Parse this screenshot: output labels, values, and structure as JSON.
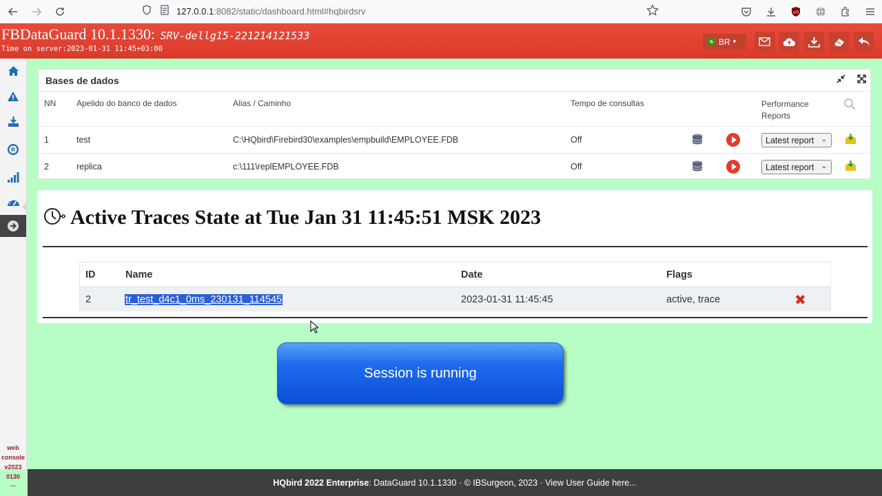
{
  "browser": {
    "url_host": "127.0.0.1",
    "url_rest": ":8082/static/dashboard.html#hqbirdsrv"
  },
  "header": {
    "title": "FBDataGuard 10.1.1330:",
    "server": "SRV-dellg15-221214121533",
    "time": "Time on server:2023-01-31 11:45+03:00",
    "lang": "BR"
  },
  "sidebar": {
    "webconsole": [
      "web",
      "console",
      "v2023",
      "0130",
      "..."
    ]
  },
  "databases": {
    "title": "Bases de dados",
    "columns": {
      "nn": "NN",
      "nickname": "Apelido do banco de dados",
      "alias": "Alias / Caminho",
      "query_time": "Tempo de consultas",
      "perf_line1": "Performance",
      "perf_line2": "Reports"
    },
    "rows": [
      {
        "nn": "1",
        "nickname": "test",
        "alias": "C:\\HQbird\\Firebird30\\examples\\empbuild\\EMPLOYEE.FDB",
        "query_time": "Off",
        "report": "Latest report"
      },
      {
        "nn": "2",
        "nickname": "replica",
        "alias": "c:\\111\\replEMPLOYEE.FDB",
        "query_time": "Off",
        "report": "Latest report"
      }
    ]
  },
  "traces": {
    "title": "Active Traces State at Tue Jan 31 11:45:51 MSK 2023",
    "columns": {
      "id": "ID",
      "name": "Name",
      "date": "Date",
      "flags": "Flags"
    },
    "rows": [
      {
        "id": "2",
        "name": "tr_test_d4c1_0ms_230131_114545",
        "date": "2023-01-31 11:45:45",
        "flags": "active, trace"
      }
    ]
  },
  "session": {
    "label": "Session is running"
  },
  "footer": {
    "product": "HQbird 2022 Enterprise",
    "rest": ": DataGuard 10.1.1330 · © IBSurgeon, 2023 · View User Guide here..."
  },
  "colors": {
    "header": "#e04434",
    "background": "#b7fec6",
    "accent_blue": "#1f6fb5",
    "session_button": "#1f6bec"
  }
}
